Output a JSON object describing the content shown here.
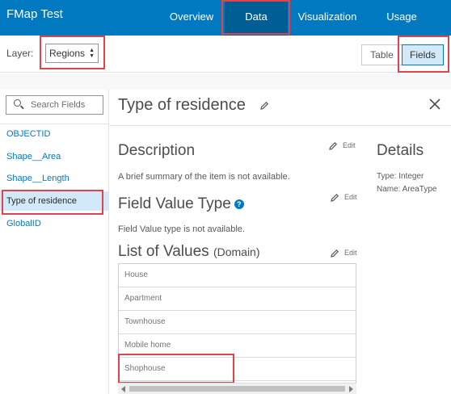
{
  "app": {
    "title": "FMap Test"
  },
  "tabs": [
    {
      "label": "Overview"
    },
    {
      "label": "Data",
      "active": true
    },
    {
      "label": "Visualization"
    },
    {
      "label": "Usage"
    }
  ],
  "toolbar": {
    "layer_label": "Layer:",
    "layer_value": "Regions",
    "view_table_label": "Table",
    "view_fields_label": "Fields",
    "active_view": "Fields"
  },
  "sidebar": {
    "search_placeholder": "Search Fields",
    "fields": [
      {
        "label": "OBJECTID"
      },
      {
        "label": "Shape__Area"
      },
      {
        "label": "Shape__Length"
      },
      {
        "label": "Type of residence",
        "selected": true
      },
      {
        "label": "GlobalID"
      }
    ]
  },
  "field": {
    "title": "Type of residence",
    "description_heading": "Description",
    "description_text": "A brief summary of the item is not available.",
    "value_type_heading": "Field Value Type",
    "value_type_text": "Field Value type is not available.",
    "list_heading": "List of Values",
    "list_heading_suffix": "(Domain)",
    "edit_label": "Edit",
    "domain_values": [
      "House",
      "Apartment",
      "Townhouse",
      "Mobile home",
      "Shophouse"
    ]
  },
  "details": {
    "heading": "Details",
    "type_line": "Type: Integer",
    "name_line": "Name: AreaType"
  },
  "colors": {
    "brand": "#0079c1",
    "brand_dark": "#005e95",
    "selected_bg": "#d2e9f9",
    "highlight": "#e0434b"
  }
}
